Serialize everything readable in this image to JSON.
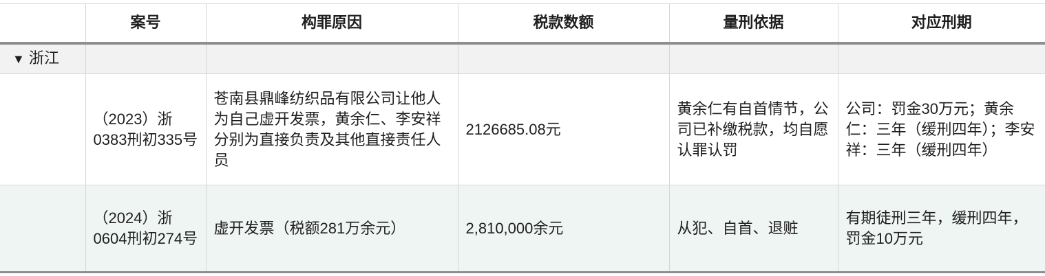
{
  "table": {
    "columns": [
      "",
      "案号",
      "构罪原因",
      "税款数额",
      "量刑依据",
      "对应刑期"
    ],
    "groups": [
      {
        "toggle": "▼",
        "label": "浙江",
        "rows": [
          {
            "case_no": "（2023）浙0383刑初335号",
            "reason": "苍南县鼎峰纺织品有限公司让他人为自己虚开发票，黄余仁、李安祥分别为直接负责及其他直接责任人员",
            "amount": "2126685.08元",
            "basis": "黄余仁有自首情节，公司已补缴税款，均自愿认罪认罚",
            "sentence": "公司：罚金30万元；黄余仁：三年（缓刑四年）；李安祥：三年（缓刑四年）"
          },
          {
            "case_no": "（2024）浙0604刑初274号",
            "reason": "虚开发票（税额281万余元）",
            "amount": "2,810,000余元",
            "basis": "从犯、自首、退赃",
            "sentence": "有期徒刑三年，缓刑四年，罚金10万元"
          }
        ]
      }
    ]
  }
}
